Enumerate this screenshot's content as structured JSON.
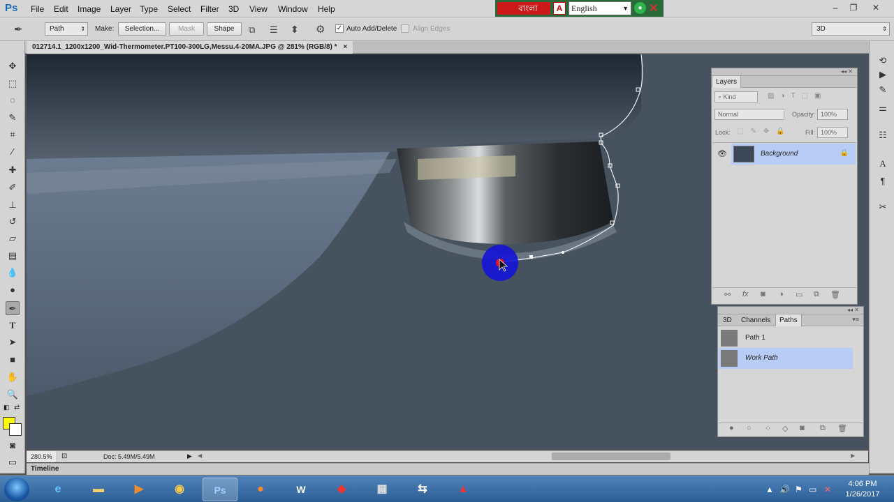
{
  "app": {
    "logo": "Ps"
  },
  "menu": [
    "File",
    "Edit",
    "Image",
    "Layer",
    "Type",
    "Select",
    "Filter",
    "3D",
    "View",
    "Window",
    "Help"
  ],
  "language_bar": {
    "bangla_label": "বাংলা",
    "language": "English",
    "acrobat": "A"
  },
  "window_controls": {
    "minimize": "–",
    "restore": "❐",
    "close": "✕"
  },
  "options": {
    "tool_mode": "Path",
    "make_label": "Make:",
    "selection_button": "Selection...",
    "mask_button": "Mask",
    "shape_button": "Shape",
    "auto_add_delete": "Auto Add/Delete",
    "auto_add_delete_checked": true,
    "align_edges": "Align Edges",
    "align_edges_checked": false,
    "workspace": "3D"
  },
  "document": {
    "tab_title": "012714.1_1200x1200_Wid-Thermometer.PT100-300LG,Messu.4-20MA.JPG @ 281% (RGB/8) *",
    "tab_close": "×"
  },
  "status": {
    "zoom": "280.5%",
    "doc": "Doc: 5.49M/5.49M"
  },
  "timeline": "Timeline",
  "layers_panel": {
    "title": "Layers",
    "kind": "Kind",
    "blend_mode": "Normal",
    "opacity_label": "Opacity:",
    "opacity": "100%",
    "lock_label": "Lock:",
    "fill_label": "Fill:",
    "fill": "100%",
    "layers": [
      {
        "name": "Background",
        "visible": true,
        "locked": true
      }
    ]
  },
  "paths_panel": {
    "tabs": [
      "3D",
      "Channels",
      "Paths"
    ],
    "active_tab": "Paths",
    "paths": [
      {
        "name": "Path 1"
      },
      {
        "name": "Work Path",
        "selected": true
      }
    ]
  },
  "taskbar": {
    "apps": [
      "internet-explorer",
      "file-explorer",
      "media-player",
      "chrome",
      "photoshop",
      "firefox",
      "word",
      "acrobat",
      "calculator",
      "teamviewer",
      "movie-maker"
    ],
    "active_app": "photoshop",
    "time": "4:06 PM",
    "date": "1/26/2017"
  },
  "colors": {
    "foreground": "#ffff00",
    "background": "#ffffff",
    "selection_highlight": "#b8cdf5"
  }
}
